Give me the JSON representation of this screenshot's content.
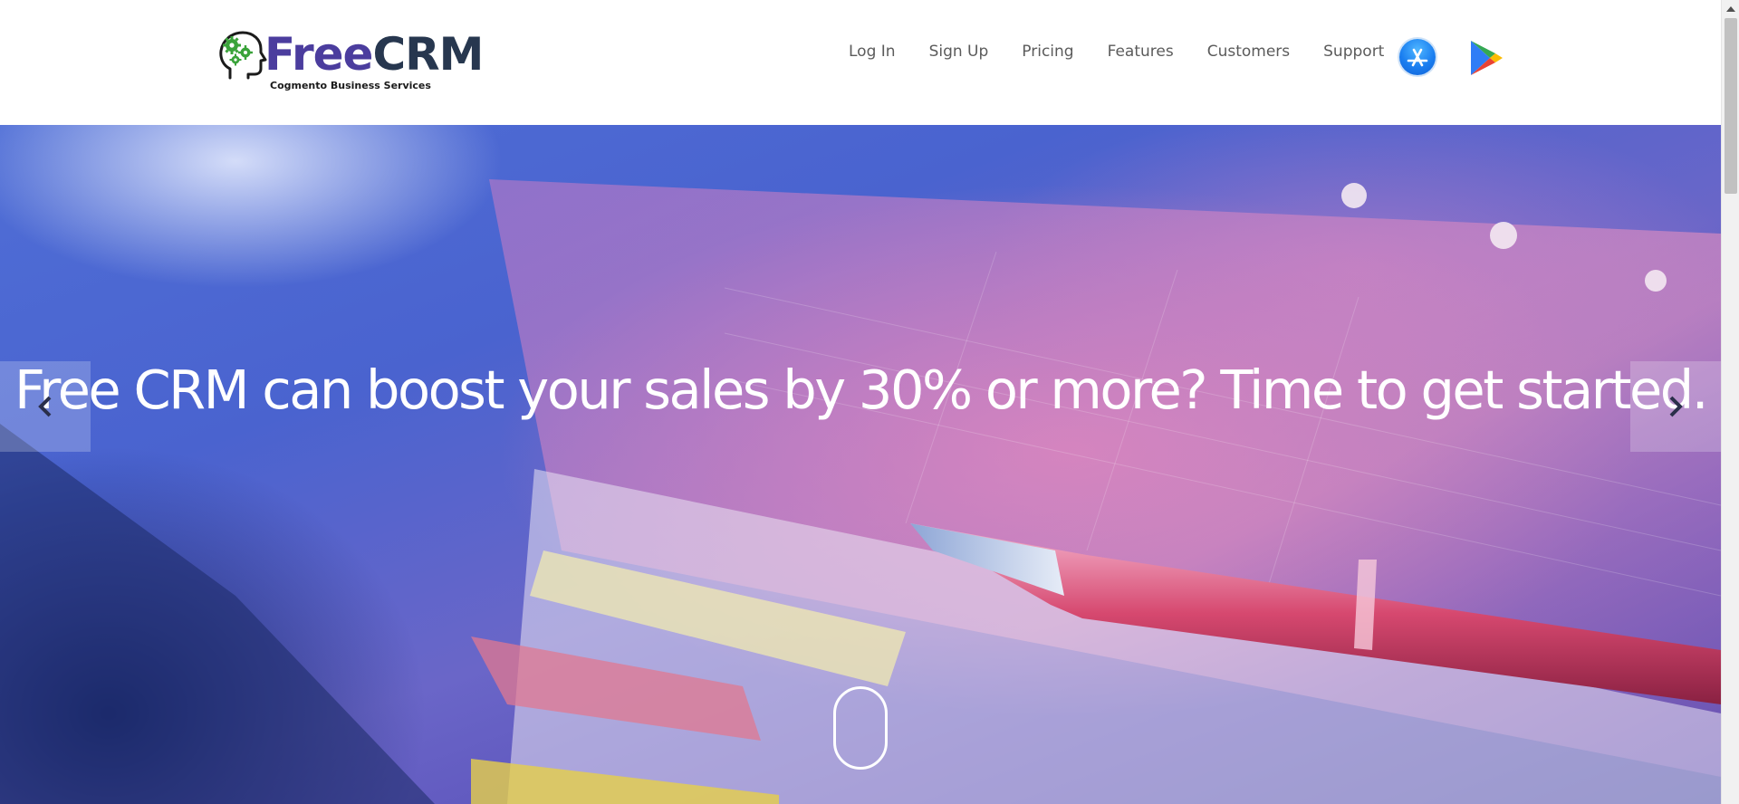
{
  "header": {
    "logo": {
      "brand_first": "Free",
      "brand_second": "CRM",
      "tagline": "Cogmento Business Services"
    },
    "nav": [
      {
        "label": "Log In"
      },
      {
        "label": "Sign Up"
      },
      {
        "label": "Pricing"
      },
      {
        "label": "Features"
      },
      {
        "label": "Customers"
      },
      {
        "label": "Support"
      }
    ],
    "store_icons": [
      "app-store-icon",
      "google-play-icon"
    ]
  },
  "hero": {
    "headline": "Free CRM can boost your sales by 30% or more? Time to get started.",
    "controls": [
      "chevron-left-icon",
      "chevron-right-icon",
      "scroll-mouse-icon"
    ]
  },
  "colors": {
    "brand_purple": "#4b3d9e",
    "brand_navy": "#27374f",
    "nav_text": "#5b5b5b",
    "hero_text": "#ffffff",
    "logo_gear_green": "#3aa33a"
  }
}
